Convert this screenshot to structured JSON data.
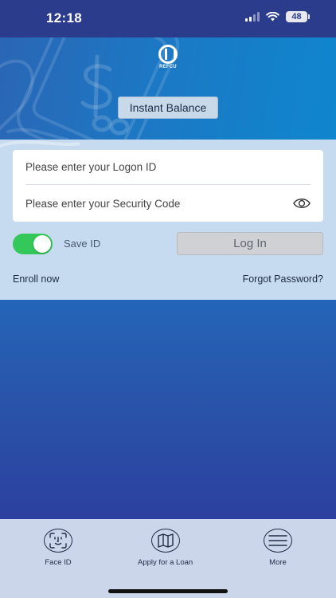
{
  "status_bar": {
    "time": "12:18",
    "battery": "48"
  },
  "header": {
    "logo_text": "REFCU",
    "instant_balance_label": "Instant Balance"
  },
  "login": {
    "logon_id_placeholder": "Please enter your Logon ID",
    "security_code_placeholder": "Please enter your Security Code",
    "save_id_label": "Save ID",
    "save_id_on": true,
    "login_label": "Log In",
    "enroll_label": "Enroll now",
    "forgot_label": "Forgot Password?"
  },
  "tabs": [
    {
      "label": "Face ID",
      "icon": "face-id-icon"
    },
    {
      "label": "Apply for a Loan",
      "icon": "map-icon"
    },
    {
      "label": "More",
      "icon": "menu-icon"
    }
  ],
  "colors": {
    "status_bar": "#2b3c8c",
    "toggle_on": "#34c759",
    "panel": "#c6dbf0",
    "tab_bar": "#cbd6ea"
  }
}
